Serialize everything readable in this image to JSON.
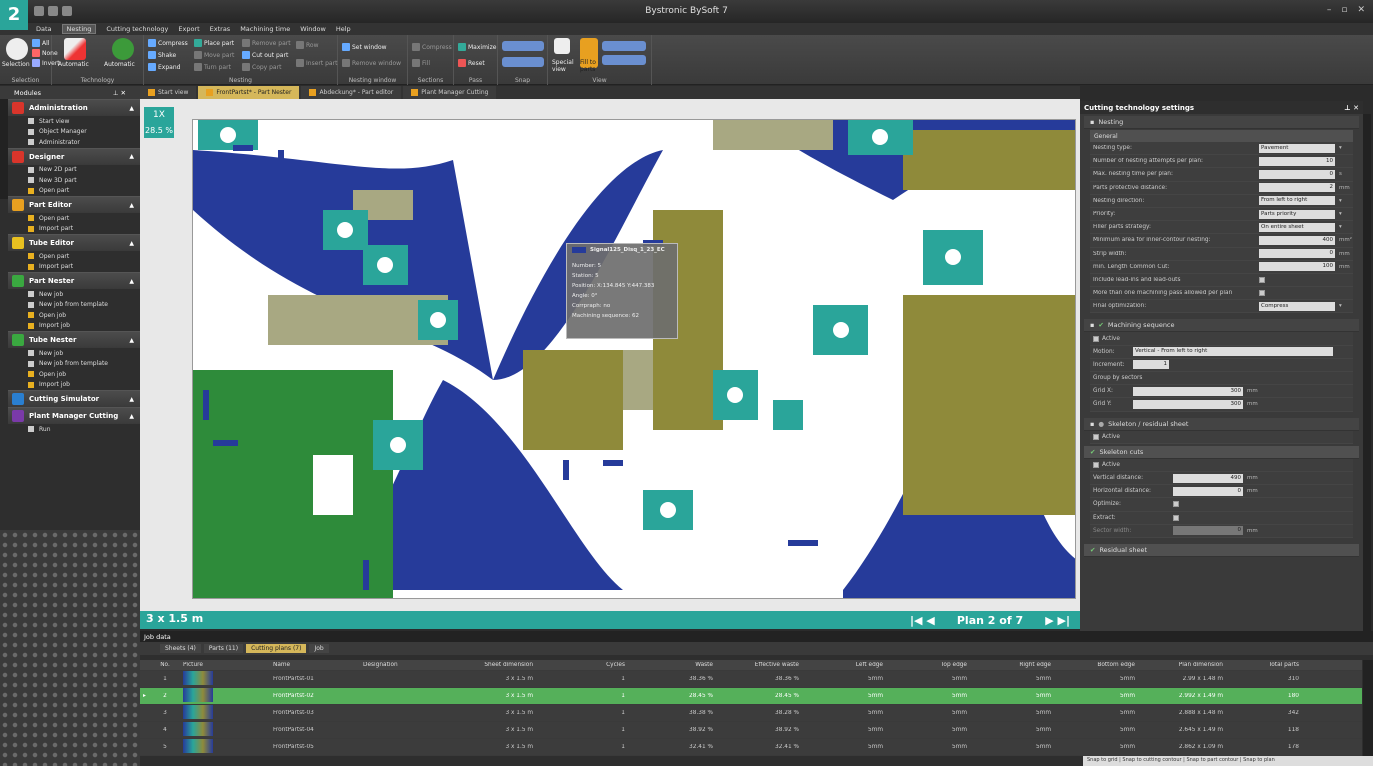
{
  "badge": "2",
  "title": "Bystronic BySoft 7",
  "window_controls": [
    "–",
    "▫",
    "✕"
  ],
  "menu": [
    "Data",
    "Nesting",
    "Cutting technology",
    "Export",
    "Extras",
    "Machining time",
    "Window",
    "Help"
  ],
  "menu_active": "Nesting",
  "ribbon": {
    "groups": [
      "Selection",
      "Technology",
      "Nesting",
      "Nesting window",
      "Sections",
      "Pass",
      "Snap",
      "View"
    ],
    "selection": {
      "big": "Selection",
      "all": "All",
      "none": "None",
      "invert": "Invert"
    },
    "technology": {
      "automatic": "Automatic",
      "automatic2": "Automatic"
    },
    "nesting": {
      "compress": "Compress",
      "shake": "Shake",
      "expand": "Expand",
      "place_part": "Place part",
      "remove_part": "Remove part",
      "row": "Row",
      "move_part": "Move part",
      "cut_out_part": "Cut out part",
      "insert_part": "Insert part",
      "turn_part": "Turn part",
      "copy_part": "Copy part"
    },
    "nesting_window": {
      "set_window": "Set window",
      "remove_window": "Remove window"
    },
    "sections": {
      "compress": "Compress",
      "fill": "Fill"
    },
    "pass": {
      "maximize": "Maximize",
      "reset": "Reset"
    },
    "view": {
      "special_view": "Special view",
      "fill_to_parts": "Fill to parts"
    }
  },
  "doc_tabs": [
    {
      "label": "Start view",
      "active": false
    },
    {
      "label": "FrontPartst* - Part Nester",
      "active": true
    },
    {
      "label": "Abdeckung* - Part editor",
      "active": false
    },
    {
      "label": "Plant Manager Cutting",
      "active": false
    }
  ],
  "modules": {
    "title": "Modules",
    "sections": [
      {
        "title": "Administration",
        "color": "#d9352b",
        "items": [
          "Start view",
          "Object Manager",
          "Administrator"
        ]
      },
      {
        "title": "Designer",
        "color": "#d9352b",
        "items": [
          "New 2D part",
          "New 3D part",
          "Open part"
        ]
      },
      {
        "title": "Part Editor",
        "color": "#e8a020",
        "items": [
          "Open part",
          "Import part"
        ]
      },
      {
        "title": "Tube Editor",
        "color": "#e8c020",
        "items": [
          "Open part",
          "Import part"
        ]
      },
      {
        "title": "Part Nester",
        "color": "#3aa840",
        "items": [
          "New job",
          "New job from template",
          "Open job",
          "Import job"
        ]
      },
      {
        "title": "Tube Nester",
        "color": "#3aa840",
        "items": [
          "New job",
          "New job from template",
          "Open job",
          "Import job"
        ]
      },
      {
        "title": "Cutting Simulator",
        "color": "#2a7fd0",
        "items": []
      },
      {
        "title": "Plant Manager Cutting",
        "color": "#7a3aa8",
        "items": [
          "Run"
        ]
      }
    ]
  },
  "canvas": {
    "zoom_label": "1X",
    "utilization": "28.5 %",
    "sheet_size": "3 x 1.5 m",
    "plan_label": "Plan 2 of 7"
  },
  "tooltip": {
    "title": "Signal125_Disq_1_23_EC",
    "number": "Number: 5",
    "station": "Station: 5",
    "position": "Position: X:134.845  Y:447.383",
    "angle": "Angle: 0°",
    "corr": "Corrpraph: no",
    "machining": "Machining sequence: 62"
  },
  "cutting_tech": {
    "title": "Cutting technology settings",
    "nesting_section": "Nesting",
    "general": "General",
    "rows": [
      {
        "label": "Nesting type:",
        "value": "Pavement",
        "unit": "",
        "kind": "select"
      },
      {
        "label": "Number of nesting attempts per plan:",
        "value": "10",
        "unit": "",
        "kind": "num"
      },
      {
        "label": "Max. nesting time per plan:",
        "value": "0",
        "unit": "s",
        "kind": "num"
      },
      {
        "label": "Parts protective distance:",
        "value": "2",
        "unit": "mm",
        "kind": "num"
      },
      {
        "label": "Nesting direction:",
        "value": "From left to right",
        "unit": "",
        "kind": "select"
      },
      {
        "label": "Priority:",
        "value": "Parts priority",
        "unit": "",
        "kind": "select"
      },
      {
        "label": "Filler parts strategy:",
        "value": "On entire sheet",
        "unit": "",
        "kind": "select"
      },
      {
        "label": "Minimum area for inner-contour nesting:",
        "value": "400",
        "unit": "mm²",
        "kind": "num"
      },
      {
        "label": "Strip width:",
        "value": "0",
        "unit": "mm",
        "kind": "num"
      },
      {
        "label": "min. Length Common Cut:",
        "value": "100",
        "unit": "mm",
        "kind": "num"
      },
      {
        "label": "Include lead-ins and lead-outs",
        "value": "",
        "unit": "",
        "kind": "chk"
      },
      {
        "label": "More than one machining pass allowed per plan",
        "value": "",
        "unit": "",
        "kind": "chk"
      },
      {
        "label": "Final optimization:",
        "value": "Compress",
        "unit": "",
        "kind": "select"
      }
    ],
    "machining_section": "Machining sequence",
    "active_label": "Active",
    "motion_label": "Motion:",
    "motion_value": "Vertical - From left to right",
    "increment_label": "Increment:",
    "increment_value": "1",
    "group_label": "Group by sectors",
    "grid_x_label": "Grid X:",
    "grid_x_value": "300",
    "grid_y_label": "Grid Y:",
    "grid_y_value": "300",
    "grid_unit": "mm",
    "skeleton_section": "Skeleton / residual sheet",
    "skeleton_cuts": "Skeleton cuts",
    "vertical_label": "Vertical distance:",
    "vertical_value": "490",
    "horizontal_label": "Horizontal distance:",
    "horizontal_value": "0",
    "optimize_label": "Optimize:",
    "extract_label": "Extract:",
    "sector_label": "Sector width:",
    "sector_value": "0",
    "dist_unit": "mm",
    "residual_label": "Residual sheet"
  },
  "job_data": {
    "title": "Job data",
    "tabs": [
      {
        "label": "Sheets (4)",
        "active": false
      },
      {
        "label": "Parts (11)",
        "active": false
      },
      {
        "label": "Cutting plans (7)",
        "active": true
      },
      {
        "label": "Job",
        "active": false
      }
    ],
    "columns": [
      "No.",
      "Picture",
      "Name",
      "Designation",
      "Sheet dimension",
      "Cycles",
      "Waste",
      "Effective waste",
      "Left edge",
      "Top edge",
      "Right edge",
      "Bottom edge",
      "Plan dimension",
      "Total parts"
    ],
    "rows": [
      {
        "no": "1",
        "name": "FrontPartst-01",
        "designation": "",
        "sheet": "3 x 1.5 m",
        "cycles": "1",
        "waste": "38.36 %",
        "eff": "38.36 %",
        "left": "5mm",
        "top": "5mm",
        "right": "5mm",
        "bottom": "5mm",
        "plan": "2.99 x 1.48 m",
        "total": "310",
        "selected": false
      },
      {
        "no": "2",
        "name": "FrontPartst-02",
        "designation": "",
        "sheet": "3 x 1.5 m",
        "cycles": "1",
        "waste": "28.45 %",
        "eff": "28.45 %",
        "left": "5mm",
        "top": "5mm",
        "right": "5mm",
        "bottom": "5mm",
        "plan": "2.992 x 1.49 m",
        "total": "180",
        "selected": true
      },
      {
        "no": "3",
        "name": "FrontPartst-03",
        "designation": "",
        "sheet": "3 x 1.5 m",
        "cycles": "1",
        "waste": "38.38 %",
        "eff": "38.28 %",
        "left": "5mm",
        "top": "5mm",
        "right": "5mm",
        "bottom": "5mm",
        "plan": "2.888 x 1.48 m",
        "total": "342",
        "selected": false
      },
      {
        "no": "4",
        "name": "FrontPartst-04",
        "designation": "",
        "sheet": "3 x 1.5 m",
        "cycles": "1",
        "waste": "38.92 %",
        "eff": "38.92 %",
        "left": "5mm",
        "top": "5mm",
        "right": "5mm",
        "bottom": "5mm",
        "plan": "2.645 x 1.49 m",
        "total": "118",
        "selected": false
      },
      {
        "no": "5",
        "name": "FrontPartst-05",
        "designation": "",
        "sheet": "3 x 1.5 m",
        "cycles": "1",
        "waste": "32.41 %",
        "eff": "32.41 %",
        "left": "5mm",
        "top": "5mm",
        "right": "5mm",
        "bottom": "5mm",
        "plan": "2.862 x 1.09 m",
        "total": "178",
        "selected": false
      }
    ]
  },
  "statusbar": "Snap to grid | Snap to cutting contour | Snap to part contour | Snap to plan",
  "colors": {
    "teal": "#2aa59a",
    "navy": "#263b9a",
    "olive": "#8f8a3a",
    "khaki": "#a8a882",
    "green": "#2e8b3a",
    "accent": "#d5b75a",
    "selected_row": "#55b05a"
  }
}
